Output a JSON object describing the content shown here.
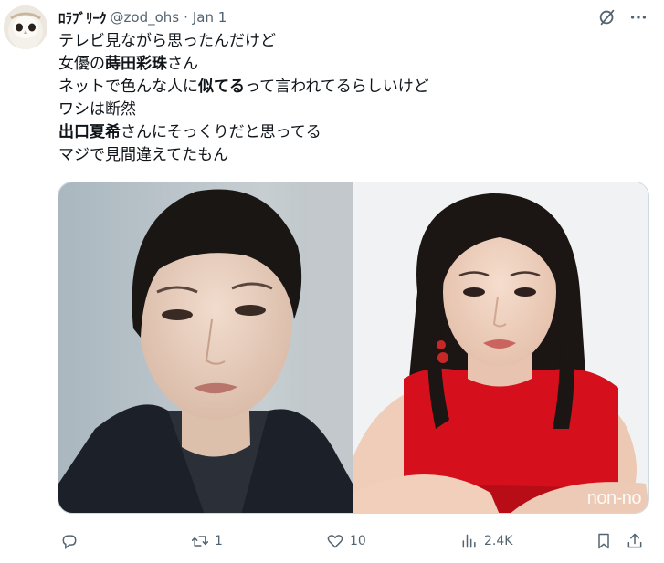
{
  "user": {
    "display_name": "ﾛﾗﾌﾞﾘｰｸ",
    "handle": "@zod_ohs",
    "separator": "·",
    "date": "Jan 1"
  },
  "tweet": {
    "lines": [
      [
        {
          "t": "テレビ見ながら思ったんだけど",
          "b": false
        }
      ],
      [
        {
          "t": "女優の",
          "b": false
        },
        {
          "t": "蒔田彩珠",
          "b": true
        },
        {
          "t": "さん",
          "b": false
        }
      ],
      [
        {
          "t": "ネットで色んな人に",
          "b": false
        },
        {
          "t": "似てる",
          "b": true
        },
        {
          "t": "って言われてるらしいけど",
          "b": false
        }
      ],
      [
        {
          "t": "ワシは断然",
          "b": false
        }
      ],
      [
        {
          "t": "出口夏希",
          "b": true
        },
        {
          "t": "さんにそっくりだと思ってる",
          "b": false
        }
      ],
      [
        {
          "t": "マジで見間違えてたもん",
          "b": false
        }
      ]
    ]
  },
  "media": {
    "right_watermark": "non-no"
  },
  "actions": {
    "reply_count": "",
    "retweet_count": "1",
    "like_count": "10",
    "views_count": "2.4K"
  },
  "icons": {
    "avatar": "owl-avatar",
    "grok": "grok-icon",
    "reply": "reply-icon",
    "retweet": "retweet-icon",
    "like": "heart-icon",
    "views": "views-icon",
    "bookmark": "bookmark-icon",
    "share": "share-icon"
  },
  "colors": {
    "text": "#0f1419",
    "muted": "#536471",
    "border": "#cfd9de"
  }
}
